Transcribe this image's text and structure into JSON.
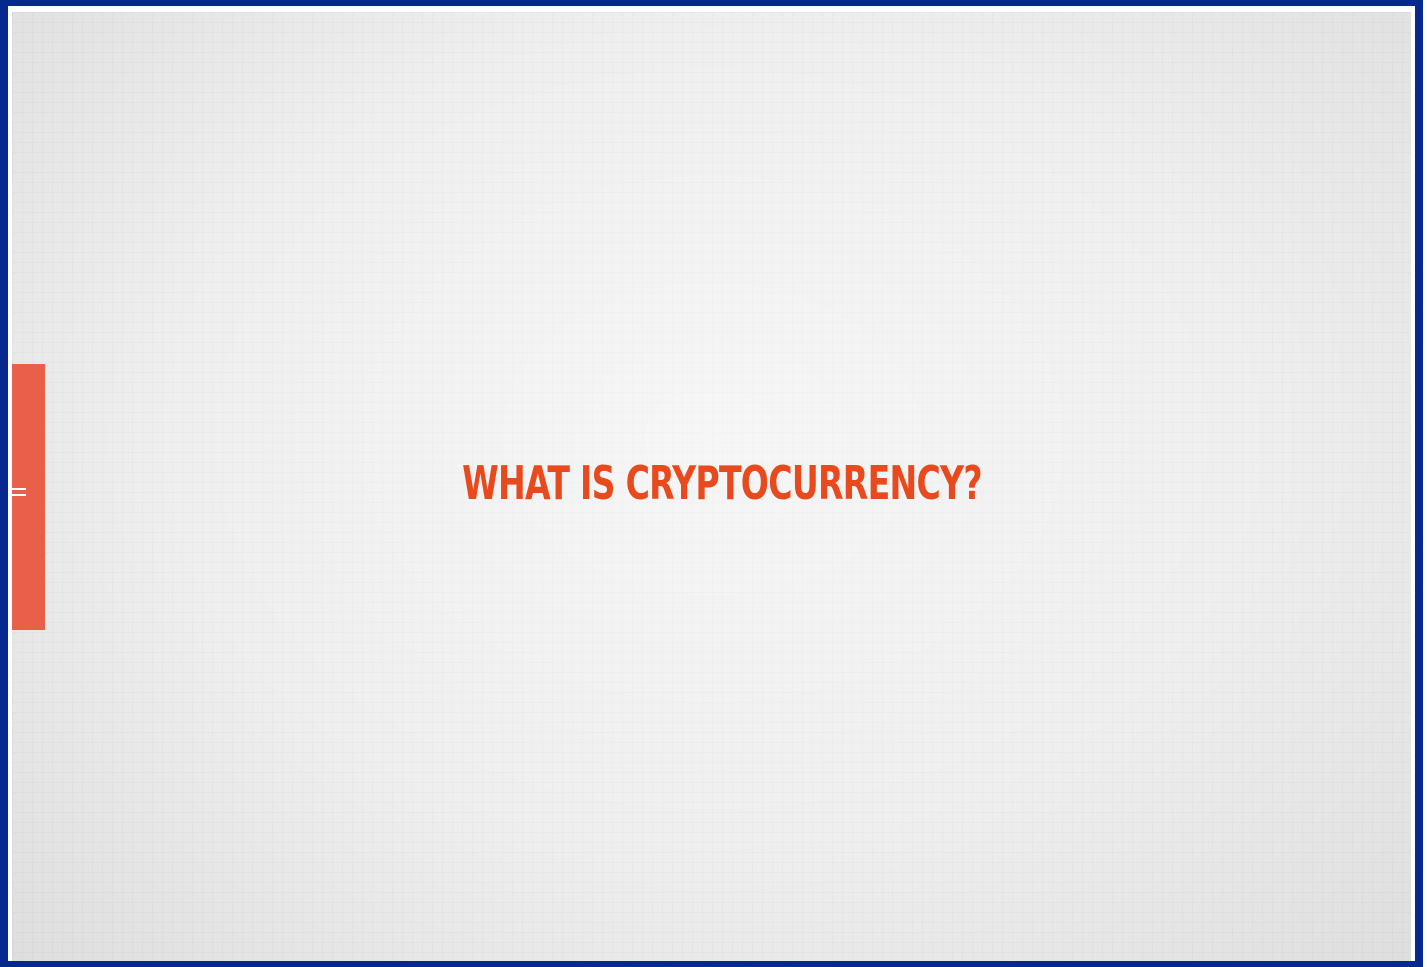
{
  "slide": {
    "headline": "WHAT IS CRYPTOCURRENCY?"
  },
  "side_tab": {
    "icon": "menu-icon"
  },
  "colors": {
    "frame_border": "#05298c",
    "background": "#ececec",
    "accent": "#e8604a",
    "headline": "#e8491d"
  }
}
